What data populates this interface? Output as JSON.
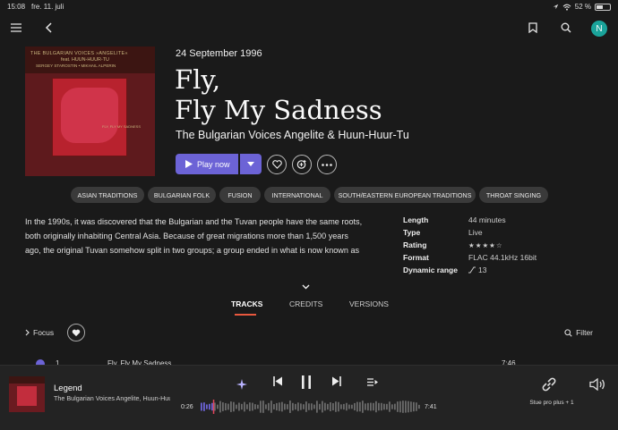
{
  "status_bar": {
    "time": "15:08",
    "date": "fre. 11. juli",
    "battery_text": "52 %",
    "battery_level": 0.52
  },
  "nav": {
    "avatar_letter": "N"
  },
  "album": {
    "cover_text_1": "THE BULGARIAN VOICES »ANGELITE«",
    "cover_text_2": "feat.  HUUN-HUUR-TU",
    "cover_text_3": "SERGEY STAROSTIN • MIKHAIL ALPERIN",
    "cover_text_4": "FLY, FLY MY SADNESS",
    "release_date": "24 September 1996",
    "title_line1": "Fly,",
    "title_line2": "Fly My Sadness",
    "artist": "The Bulgarian Voices Angelite & Huun-Huur-Tu",
    "play_label": "Play now"
  },
  "tags": [
    "ASIAN TRADITIONS",
    "BULGARIAN FOLK",
    "FUSION",
    "INTERNATIONAL",
    "SOUTH/EASTERN EUROPEAN TRADITIONS",
    "THROAT SINGING"
  ],
  "description": [
    "In the 1990s, it was discovered that the Bulgarian and the Tuvan people have the same roots,",
    "both originally inhabiting Central Asia. Because of great migrations more than 1,500 years",
    "ago, the original Tuvan somehow split in two groups; a group ended in what is now known as"
  ],
  "details": [
    {
      "key": "Length",
      "value": "44 minutes"
    },
    {
      "key": "Type",
      "value": "Live"
    },
    {
      "key": "Rating",
      "value": "★★★★☆",
      "stars": 4.5
    },
    {
      "key": "Format",
      "value": "FLAC 44.1kHz 16bit"
    },
    {
      "key": "Dynamic range",
      "value": "13"
    }
  ],
  "tabs": [
    "TRACKS",
    "CREDITS",
    "VERSIONS"
  ],
  "controls": {
    "focus_label": "Focus",
    "filter_label": "Filter"
  },
  "track_row": {
    "number": "1",
    "title": "Fly, Fly My Sadness",
    "duration": "7:46"
  },
  "player": {
    "title": "Legend",
    "artist": "The Bulgarian Voices Angelite, Huun-Huur",
    "current_time": "0:26",
    "total_time": "7:41",
    "progress": 0.056,
    "device": "Stue pro plus + 1"
  },
  "colors": {
    "accent": "#6c63d6",
    "tab_underline": "#e8583e",
    "avatar": "#1aa39a",
    "progress_marker": "#e0455a"
  }
}
